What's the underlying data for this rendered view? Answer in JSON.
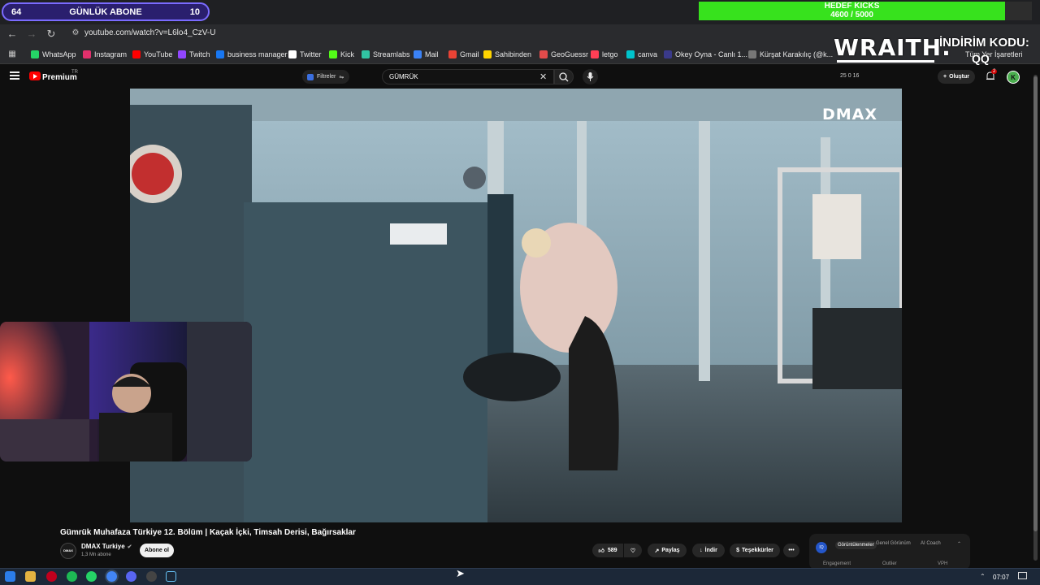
{
  "overlay": {
    "sub_goal": {
      "left": "64",
      "label": "GÜNLÜK ABONE",
      "right": "10"
    },
    "kicks_goal": {
      "label": "HEDEF KICKS",
      "progress": "4600 / 5000",
      "fraction": 0.92
    },
    "brand": "WRAITH.",
    "promo_label": "İNDİRİM KODU:",
    "promo_code": "QQ"
  },
  "browser": {
    "url": "youtube.com/watch?v=L6lo4_CzV-U",
    "bookmarks": [
      {
        "label": "WhatsApp",
        "color": "#25d366"
      },
      {
        "label": "Instagram",
        "color": "#e1306c"
      },
      {
        "label": "YouTube",
        "color": "#ff0000"
      },
      {
        "label": "Twitch",
        "color": "#9146ff"
      },
      {
        "label": "business manager",
        "color": "#1877f2"
      },
      {
        "label": "Twitter",
        "color": "#ffffff"
      },
      {
        "label": "Kick",
        "color": "#53fc18"
      },
      {
        "label": "Streamlabs",
        "color": "#31c3a2"
      },
      {
        "label": "Mail",
        "color": "#3b82f6"
      },
      {
        "label": "Gmail",
        "color": "#ea4335"
      },
      {
        "label": "Sahibinden",
        "color": "#ffd400"
      },
      {
        "label": "GeoGuessr",
        "color": "#e34b4b"
      },
      {
        "label": "letgo",
        "color": "#ff3f55"
      },
      {
        "label": "canva",
        "color": "#00c4cc"
      },
      {
        "label": "Okey Oyna - Canlı 1...",
        "color": "#3a3a8a"
      },
      {
        "label": "Kürşat Karakılıç (@k...",
        "color": "#777777"
      }
    ],
    "other_bookmarks": "Tüm Yer İşaretleri"
  },
  "youtube": {
    "premium": "Premium",
    "region": "TR",
    "filters": "Filtreler",
    "search_query": "GÜMRÜK",
    "stats": "25  0  16",
    "create": "Oluştur",
    "notif_count": "2",
    "avatar_letter": "K",
    "video": {
      "watermark": "DMAX",
      "title": "Gümrük Muhafaza Türkiye 12. Bölüm | Kaçak İçki, Timsah Derisi, Bağırsaklar",
      "channel": "DMAX Turkiye",
      "channel_avatar": "DMAX",
      "subs": "1,3 Mn abone",
      "subscribe": "Abone ol",
      "likes": "589",
      "share": "Paylaş",
      "download": "İndir",
      "thanks": "Teşekkürler",
      "more": "•••"
    },
    "panel": {
      "tabs": [
        "Görüntülenmeler",
        "Genel Görünüm",
        "AI Coach"
      ],
      "footer": [
        "Engagement",
        "Outlier",
        "VPH"
      ],
      "icon_letter": "IQ"
    }
  },
  "taskbar": {
    "time": "07:07"
  },
  "colors": {
    "youtube_red": "#ff0000",
    "goal_green": "#37e21d",
    "sub_pill": "#2a1f6e"
  }
}
